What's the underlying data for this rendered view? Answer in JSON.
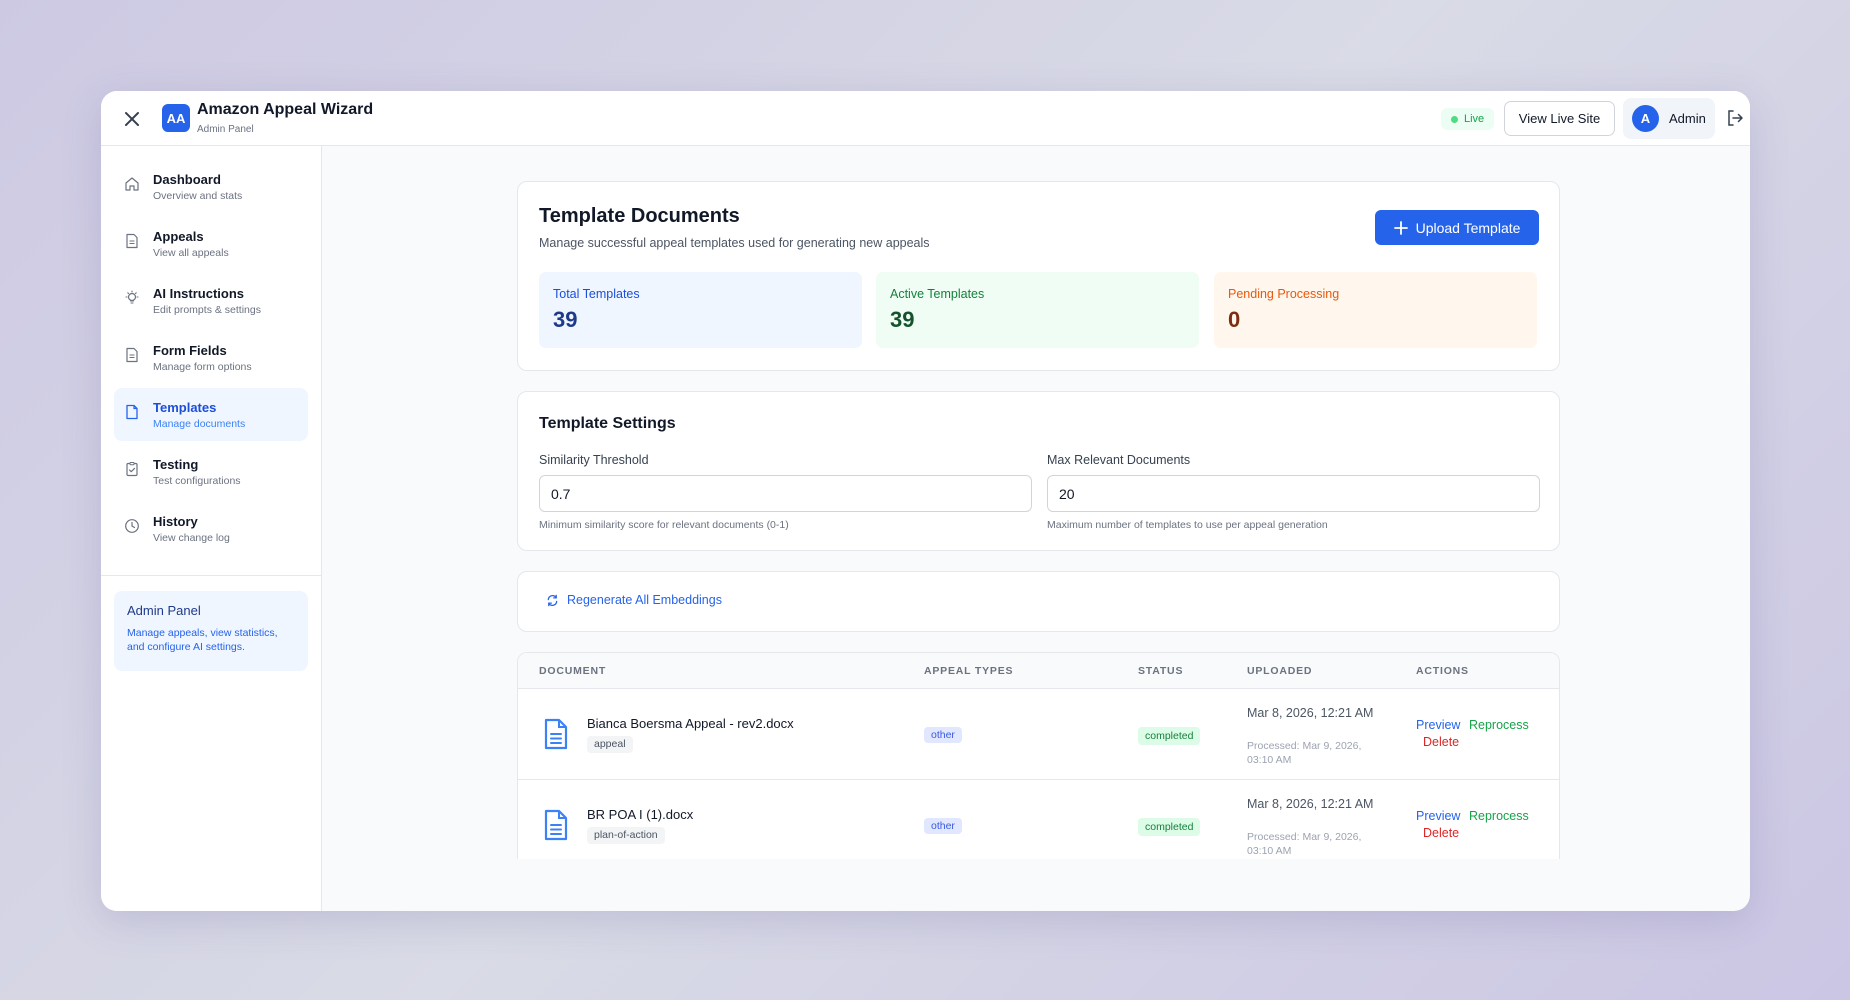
{
  "header": {
    "logo_text": "AA",
    "title": "Amazon Appeal Wizard",
    "subtitle": "Admin Panel",
    "live_label": "Live",
    "view_live_label": "View Live Site",
    "avatar_initial": "A",
    "user_name": "Admin"
  },
  "sidebar": {
    "items": [
      {
        "label": "Dashboard",
        "desc": "Overview and stats",
        "icon": "home-icon"
      },
      {
        "label": "Appeals",
        "desc": "View all appeals",
        "icon": "file-text-icon"
      },
      {
        "label": "AI Instructions",
        "desc": "Edit prompts & settings",
        "icon": "lightbulb-icon"
      },
      {
        "label": "Form Fields",
        "desc": "Manage form options",
        "icon": "file-text-icon"
      },
      {
        "label": "Templates",
        "desc": "Manage documents",
        "icon": "file-icon",
        "active": true
      },
      {
        "label": "Testing",
        "desc": "Test configurations",
        "icon": "clipboard-check-icon"
      },
      {
        "label": "History",
        "desc": "View change log",
        "icon": "clock-icon"
      }
    ],
    "info_title": "Admin Panel",
    "info_text": "Manage appeals, view statistics, and configure AI settings."
  },
  "templates": {
    "title": "Template Documents",
    "subtitle": "Manage successful appeal templates used for generating new appeals",
    "upload_label": "Upload Template",
    "stats": [
      {
        "label": "Total Templates",
        "value": "39"
      },
      {
        "label": "Active Templates",
        "value": "39"
      },
      {
        "label": "Pending Processing",
        "value": "0"
      }
    ]
  },
  "settings": {
    "title": "Template Settings",
    "similarity_label": "Similarity Threshold",
    "similarity_value": "0.7",
    "similarity_help": "Minimum similarity score for relevant documents (0-1)",
    "max_docs_label": "Max Relevant Documents",
    "max_docs_value": "20",
    "max_docs_help": "Maximum number of templates to use per appeal generation"
  },
  "regenerate_label": "Regenerate All Embeddings",
  "table": {
    "headers": [
      "DOCUMENT",
      "APPEAL TYPES",
      "STATUS",
      "UPLOADED",
      "ACTIONS"
    ],
    "rows": [
      {
        "name": "Bianca Boersma Appeal - rev2.docx",
        "tag": "appeal",
        "appeal_type": "other",
        "status": "completed",
        "uploaded": "Mar 8, 2026, 12:21 AM",
        "processed": "Processed: Mar 9, 2026, 03:10 AM"
      },
      {
        "name": "BR POA I (1).docx",
        "tag": "plan-of-action",
        "appeal_type": "other",
        "status": "completed",
        "uploaded": "Mar 8, 2026, 12:21 AM",
        "processed": "Processed: Mar 9, 2026, 03:10 AM"
      }
    ],
    "actions": {
      "preview": "Preview",
      "reprocess": "Reprocess",
      "delete": "Delete"
    }
  },
  "colors": {
    "accent": "#2563eb",
    "success": "#16a34a",
    "danger": "#dc2626",
    "warning": "#ea580c"
  }
}
